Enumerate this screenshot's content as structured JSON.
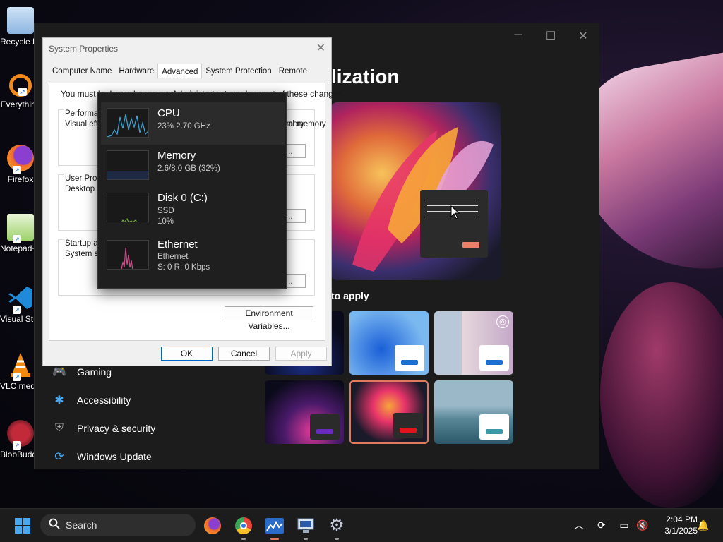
{
  "desktop": {
    "icons": [
      {
        "label": "Recycle Bin",
        "icon": "recycle-bin-icon"
      },
      {
        "label": "Everything",
        "icon": "everything-search-icon"
      },
      {
        "label": "Firefox",
        "icon": "firefox-icon"
      },
      {
        "label": "Notepad++",
        "icon": "notepad-plus-icon"
      },
      {
        "label": "Visual Studio Code",
        "icon": "vscode-icon"
      },
      {
        "label": "VLC media player",
        "icon": "vlc-icon"
      },
      {
        "label": "BlobBuddy",
        "icon": "blob-icon"
      }
    ]
  },
  "settings": {
    "title": "lization",
    "window_controls": {
      "minimize": "─",
      "maximize": "☐",
      "close": "✕"
    },
    "themes_label": "to apply",
    "nav": [
      {
        "label": "Gaming",
        "icon": "gaming-icon"
      },
      {
        "label": "Accessibility",
        "icon": "accessibility-icon"
      },
      {
        "label": "Privacy & security",
        "icon": "shield-icon"
      },
      {
        "label": "Windows Update",
        "icon": "windows-update-icon"
      }
    ],
    "colors": {
      "accent_selected": "#e07a5f"
    }
  },
  "sysprop": {
    "title": "System Properties",
    "close": "✕",
    "tabs": [
      "Computer Name",
      "Hardware",
      "Advanced",
      "System Protection",
      "Remote"
    ],
    "active_tab": "Advanced",
    "note": "You must be logged on as an Administrator to make most of these changes.",
    "groups": [
      {
        "title": "Performance",
        "desc": "Visual effects, processor scheduling, memory usage, and virtual memory",
        "desc_right": "mory",
        "button": "Settings..."
      },
      {
        "title": "User Profiles",
        "desc": "Desktop settings related to your sign-in",
        "button": "Settings..."
      },
      {
        "title": "Startup and Recovery",
        "desc": "System startup, system failure, and debugging information",
        "button": "Settings..."
      }
    ],
    "env_button": "Environment Variables...",
    "ok": "OK",
    "cancel": "Cancel",
    "apply": "Apply"
  },
  "perf": {
    "items": [
      {
        "name": "CPU",
        "lines": [
          "23%  2.70 GHz"
        ],
        "color": "#3fa8d6"
      },
      {
        "name": "Memory",
        "lines": [
          "2.6/8.0 GB (32%)"
        ],
        "color": "#3f6fd6"
      },
      {
        "name": "Disk 0 (C:)",
        "lines": [
          "SSD",
          "10%"
        ],
        "color": "#7ab648"
      },
      {
        "name": "Ethernet",
        "lines": [
          "Ethernet",
          "S: 0  R: 0 Kbps"
        ],
        "color": "#d04a8a"
      }
    ]
  },
  "taskbar": {
    "search_placeholder": "Search",
    "apps": [
      "start-icon",
      "firefox-icon",
      "chrome-icon",
      "task-manager-icon",
      "system-properties-icon",
      "settings-gear-icon"
    ],
    "time": "2:04 PM",
    "date": "3/1/2025"
  }
}
